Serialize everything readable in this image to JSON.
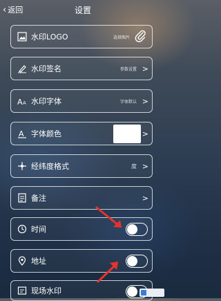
{
  "header": {
    "back_label": "返回",
    "title": "设置"
  },
  "rows": [
    {
      "label": "水印LOGO",
      "value": "选择图片"
    },
    {
      "label": "水印签名",
      "value": "参数设置"
    },
    {
      "label": "水印字体",
      "value": "字体默认"
    },
    {
      "label": "字体颜色"
    },
    {
      "label": "经纬度格式",
      "value": "度"
    },
    {
      "label": "备注"
    },
    {
      "label": "时间"
    },
    {
      "label": "地址"
    },
    {
      "label": "现场水印"
    }
  ],
  "colors": {
    "arrow": "#e8322c",
    "swatch": "#ffffff"
  },
  "icons": [
    "image-icon",
    "pen-icon",
    "font-icon",
    "text-color-icon",
    "coordinates-icon",
    "note-icon",
    "clock-icon",
    "location-pin-icon",
    "watermark-icon",
    "paperclip-icon"
  ]
}
